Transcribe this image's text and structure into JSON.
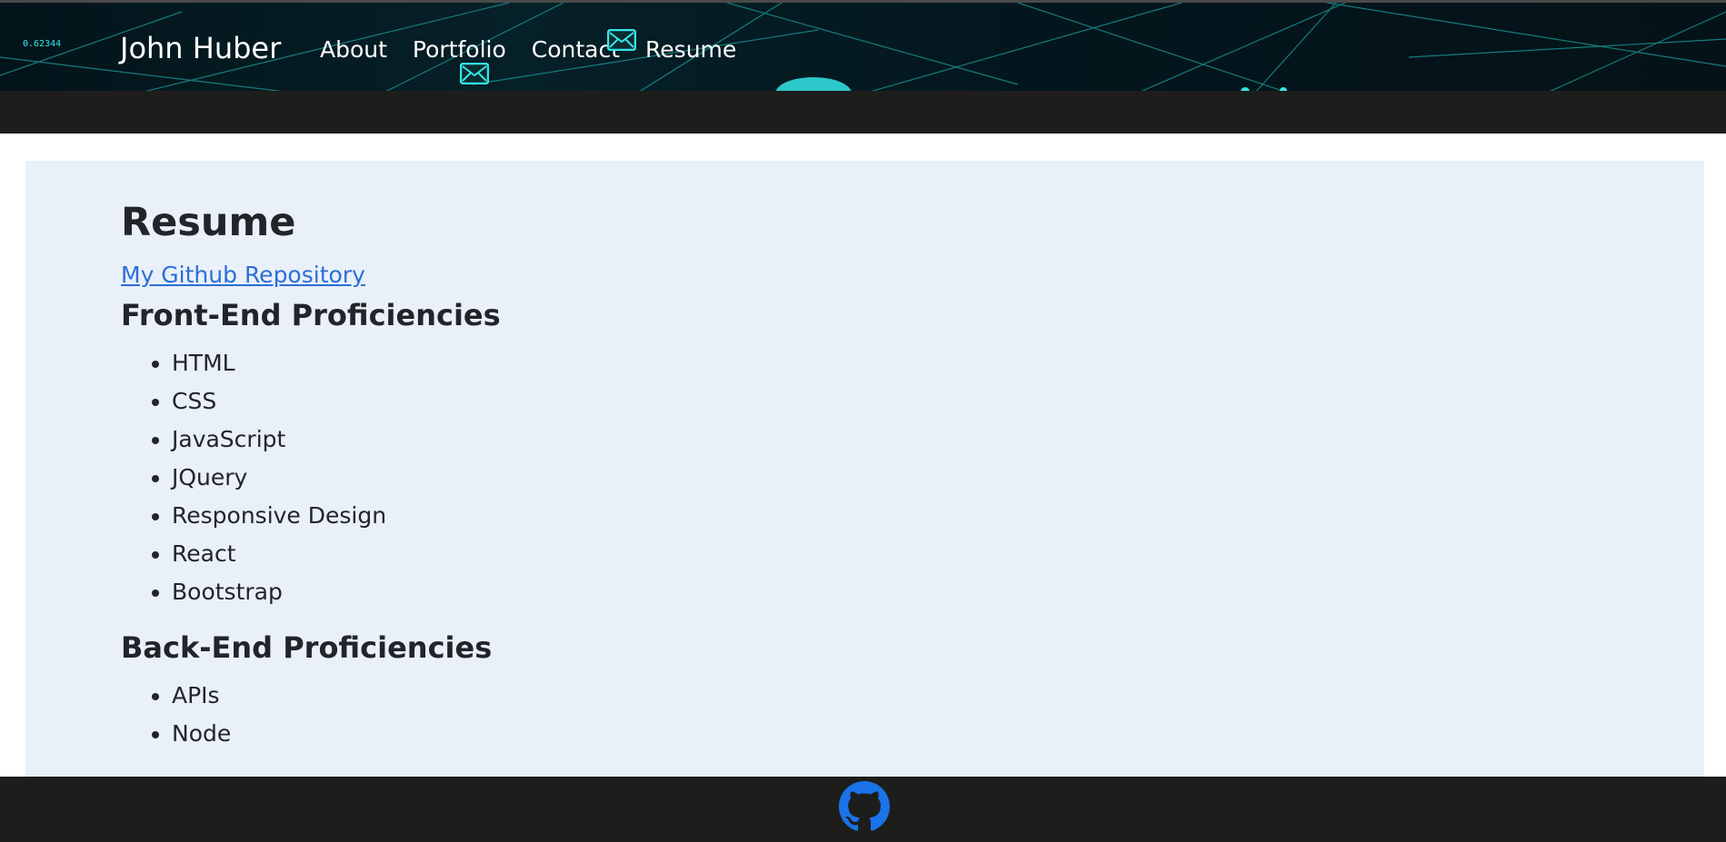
{
  "header": {
    "counter_text": "0.62344",
    "brand": "John Huber",
    "nav": [
      {
        "label": "About"
      },
      {
        "label": "Portfolio"
      },
      {
        "label": "Contact"
      },
      {
        "label": "Resume"
      }
    ]
  },
  "main": {
    "title": "Resume",
    "repo_link": "My Github Repository",
    "front_end": {
      "heading": "Front-End Proficiencies",
      "items": [
        "HTML",
        "CSS",
        "JavaScript",
        "JQuery",
        "Responsive Design",
        "React",
        "Bootstrap"
      ]
    },
    "back_end": {
      "heading": "Back-End Proficiencies",
      "items": [
        "APIs",
        "Node"
      ]
    }
  },
  "footer": {
    "icon": "github-icon"
  },
  "colors": {
    "header_bg": "#03141a",
    "bar_bg": "#1d1e1c",
    "main_bg": "#e9f0f9",
    "link": "#2a6fd6",
    "github_icon": "#1a73e8",
    "accent_cyan": "#35e6e6"
  }
}
